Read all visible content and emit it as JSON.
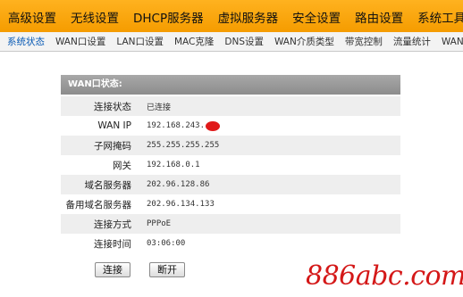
{
  "top_nav": [
    "高级设置",
    "无线设置",
    "DHCP服务器",
    "虚拟服务器",
    "安全设置",
    "路由设置",
    "系统工具"
  ],
  "sub_nav": [
    "系统状态",
    "WAN口设置",
    "LAN口设置",
    "MAC克隆",
    "DNS设置",
    "WAN介质类型",
    "带宽控制",
    "流量统计",
    "WAN速率"
  ],
  "panel": {
    "title": "WAN口状态:",
    "rows": [
      {
        "label": "连接状态",
        "value": "已连接"
      },
      {
        "label": "WAN IP",
        "value": "192.168.243."
      },
      {
        "label": "子网掩码",
        "value": "255.255.255.255"
      },
      {
        "label": "网关",
        "value": "192.168.0.1"
      },
      {
        "label": "域名服务器",
        "value": "202.96.128.86"
      },
      {
        "label": "备用域名服务器",
        "value": "202.96.134.133"
      },
      {
        "label": "连接方式",
        "value": "PPPoE"
      },
      {
        "label": "连接时间",
        "value": "03:06:00"
      }
    ]
  },
  "buttons": {
    "connect": "连接",
    "disconnect": "断开"
  },
  "watermark": "886abc.com",
  "colors": {
    "nav_orange": "#f59c00",
    "redact_red": "#e01a1a",
    "watermark_red": "#d41818"
  }
}
